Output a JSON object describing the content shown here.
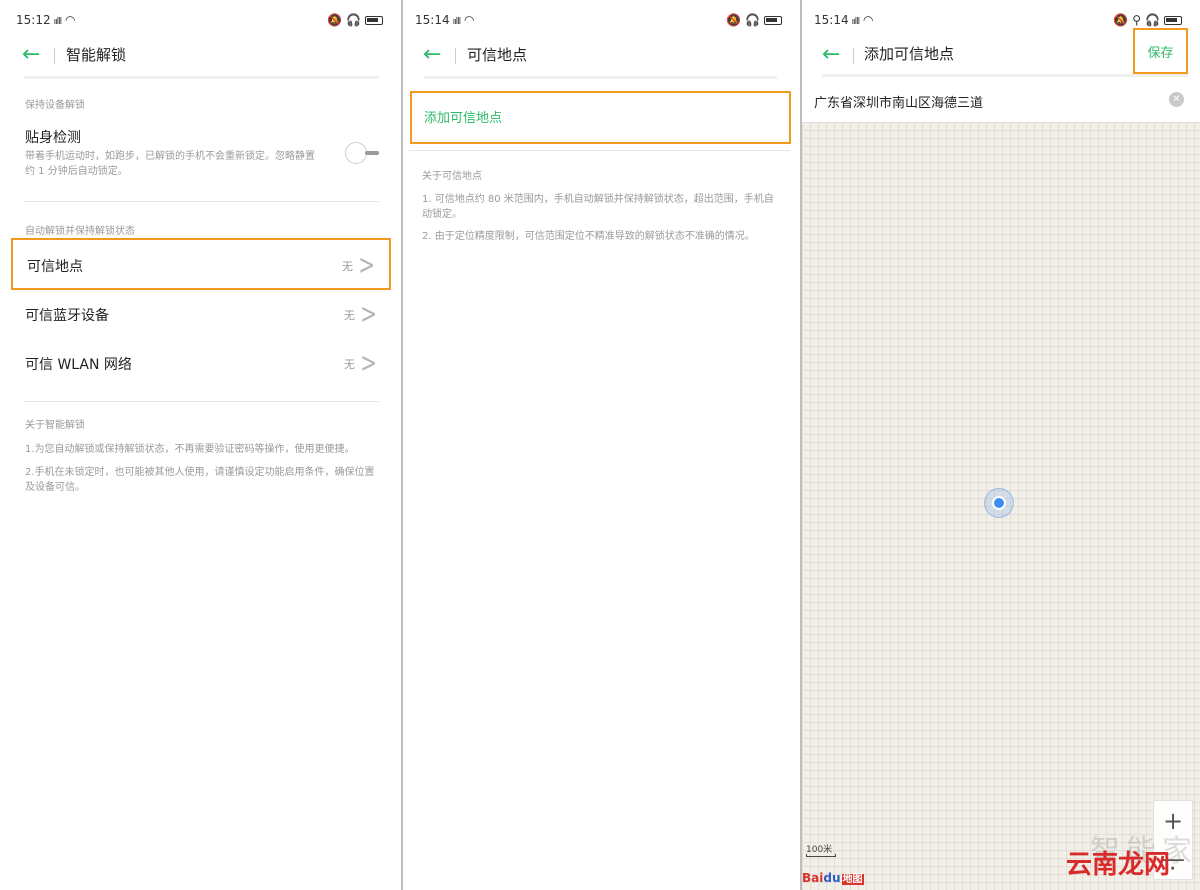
{
  "panel1": {
    "status": {
      "time": "15:12",
      "signal": "ıılll"
    },
    "title": "智能解锁",
    "section_keep_unlocked": "保持设备解锁",
    "body_detect": {
      "title": "贴身检测",
      "desc": "带着手机运动时，如跑步，已解锁的手机不会重新锁定。忽略静置约 1 分钟后自动锁定。"
    },
    "section_auto_unlock": "自动解锁并保持解锁状态",
    "rows": [
      {
        "label": "可信地点",
        "value": "无"
      },
      {
        "label": "可信蓝牙设备",
        "value": "无"
      },
      {
        "label": "可信 WLAN 网络",
        "value": "无"
      }
    ],
    "section_about": "关于智能解锁",
    "about_1": "1.为您自动解锁或保持解锁状态，不再需要验证密码等操作，使用更便捷。",
    "about_2": "2.手机在未锁定时，也可能被其他人使用，请谨慎设定功能启用条件，确保位置及设备可信。"
  },
  "panel2": {
    "status": {
      "time": "15:14",
      "signal": "ıılll"
    },
    "title": "可信地点",
    "add_label": "添加可信地点",
    "section_about": "关于可信地点",
    "about_1": "1. 可信地点约 80 米范围内，手机自动解锁并保持解锁状态，超出范围，手机自动锁定。",
    "about_2": "2. 由于定位精度限制，可信范围定位不精准导致的解锁状态不准确的情况。"
  },
  "panel3": {
    "status": {
      "time": "15:14",
      "signal": "ıılll"
    },
    "title": "添加可信地点",
    "save_label": "保存",
    "address": "广东省深圳市南山区海德三道",
    "zoom_in": "+",
    "zoom_out": "—",
    "scale": "100米",
    "baidu_bai": "Bai",
    "baidu_du": "du",
    "baidu_map": "地图"
  },
  "watermark": {
    "line1": "智能家",
    "line2": "云南龙网",
    "dot": "·"
  },
  "colors": {
    "accent": "#2dbb6b",
    "highlight": "#f29a1f",
    "locator": "#3d8ef0"
  }
}
